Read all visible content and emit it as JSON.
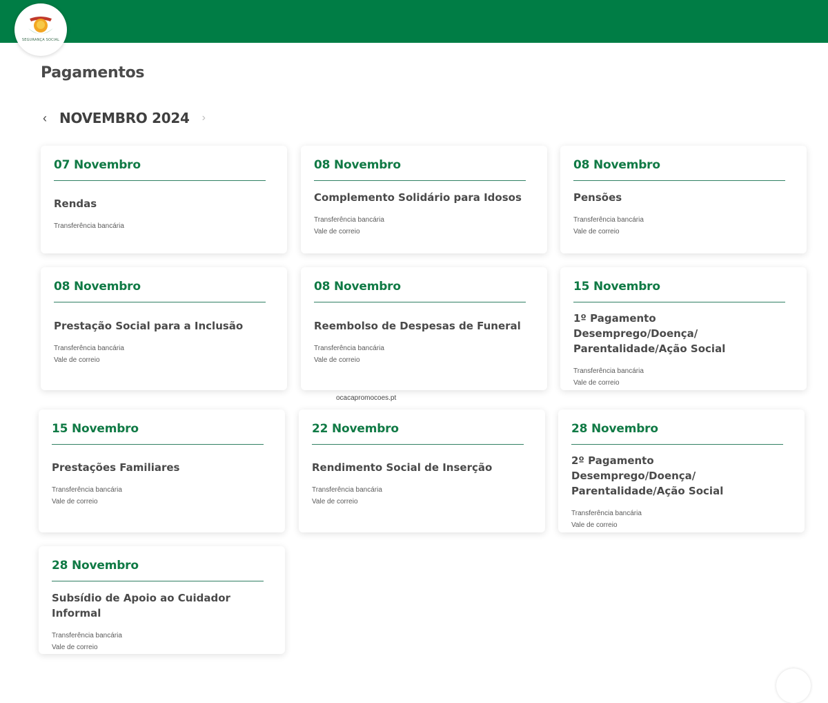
{
  "header": {
    "logo_text": "SEGURANÇA SOCIAL",
    "brand_color": "#007d45"
  },
  "page": {
    "title": "Pagamentos"
  },
  "month_nav": {
    "prev_icon": "chevron-left-icon",
    "next_icon": "chevron-right-icon",
    "label": "NOVEMBRO 2024"
  },
  "watermark": "ocacapromocoes.pt",
  "cards": [
    {
      "date": "07 Novembro",
      "title": "Rendas",
      "methods": [
        "Transferência bancária"
      ]
    },
    {
      "date": "08 Novembro",
      "title": "Complemento Solidário para Idosos",
      "methods": [
        "Transferência bancária",
        "Vale de correio"
      ]
    },
    {
      "date": "08 Novembro",
      "title": "Pensões",
      "methods": [
        "Transferência bancária",
        "Vale de correio"
      ]
    },
    {
      "date": "08 Novembro",
      "title": "Prestação Social para a Inclusão",
      "methods": [
        "Transferência bancária",
        "Vale de correio"
      ]
    },
    {
      "date": "08 Novembro",
      "title": "Reembolso de Despesas de Funeral",
      "methods": [
        "Transferência bancária",
        "Vale de correio"
      ]
    },
    {
      "date": "15 Novembro",
      "title": "1º Pagamento Desemprego/Doença/ Parentalidade/Ação Social",
      "methods": [
        "Transferência bancária",
        "Vale de correio"
      ]
    },
    {
      "date": "15 Novembro",
      "title": "Prestações Familiares",
      "methods": [
        "Transferência bancária",
        "Vale de correio"
      ]
    },
    {
      "date": "22 Novembro",
      "title": "Rendimento Social de Inserção",
      "methods": [
        "Transferência bancária",
        "Vale de correio"
      ]
    },
    {
      "date": "28 Novembro",
      "title": "2º Pagamento Desemprego/Doença/ Parentalidade/Ação Social",
      "methods": [
        "Transferência bancária",
        "Vale de correio"
      ]
    },
    {
      "date": "28 Novembro",
      "title": "Subsídio de Apoio ao Cuidador Informal",
      "methods": [
        "Transferência bancária",
        "Vale de correio"
      ]
    }
  ]
}
